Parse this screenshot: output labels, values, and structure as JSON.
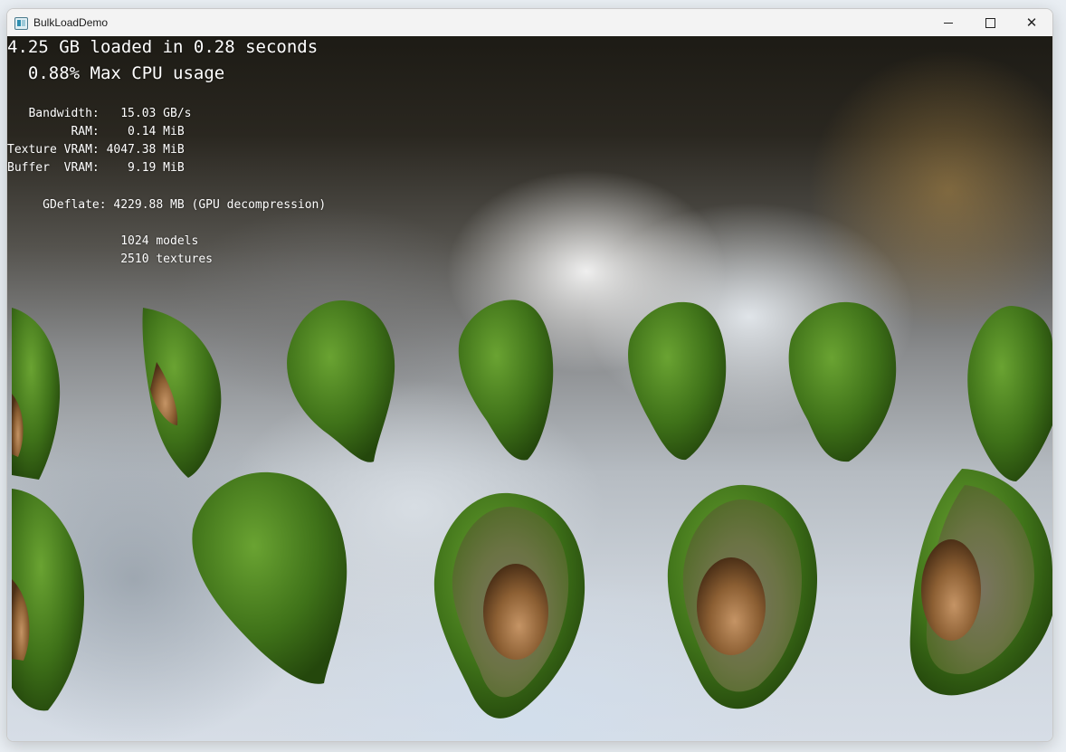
{
  "window": {
    "title": "BulkLoadDemo",
    "controls": {
      "minimize": "",
      "maximize": "",
      "close": "✕"
    }
  },
  "stats": {
    "headline": "4.25 GB loaded in 0.28 seconds",
    "cpu": "  0.88% Max CPU usage",
    "lines": [
      "   Bandwidth:   15.03 GB/s",
      "         RAM:    0.14 MiB",
      "Texture VRAM: 4047.38 MiB",
      "Buffer  VRAM:    9.19 MiB",
      "     GDeflate: 4229.88 MB (GPU decompression)",
      "                1024 models",
      "                2510 textures"
    ]
  },
  "colors": {
    "skin_dark": "#2f5a12",
    "skin_light": "#5f9a2c",
    "flesh_outer": "#556b2a",
    "flesh_inner": "#6e6b55",
    "pit_dark": "#5a3a1c",
    "pit_light": "#b8875a"
  }
}
